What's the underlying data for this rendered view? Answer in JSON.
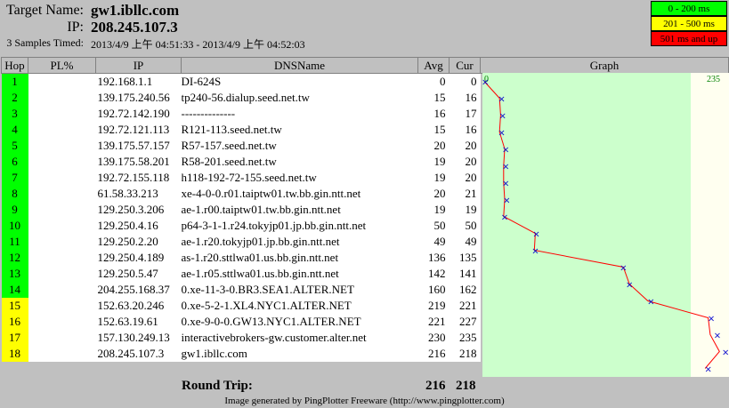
{
  "header": {
    "target_label": "Target Name:",
    "target_value": "gw1.ibllc.com",
    "ip_label": "IP:",
    "ip_value": "208.245.107.3",
    "samples_label": "3 Samples Timed:",
    "samples_value": "2013/4/9 上午 04:51:33 - 2013/4/9 上午 04:52:03"
  },
  "legend": [
    {
      "label": "0 - 200 ms",
      "color": "#00ff00"
    },
    {
      "label": "201 - 500 ms",
      "color": "#ffff00"
    },
    {
      "label": "501 ms and up",
      "color": "#ff0000"
    }
  ],
  "columns": {
    "hop": "Hop",
    "pl": "PL%",
    "ip": "IP",
    "dns": "DNSName",
    "avg": "Avg",
    "cur": "Cur",
    "graph": "Graph"
  },
  "graph_scale": {
    "min_label": "0",
    "max_label": "235",
    "max": 235
  },
  "colors": {
    "good": "#00ff00",
    "warn": "#ffff00",
    "graph_bg_good": "#ccffcc",
    "graph_bg_warn": "#fffff0",
    "line": "#ff0000",
    "marker": "#0000cc"
  },
  "rows": [
    {
      "hop": "1",
      "pl": "",
      "ip": "192.168.1.1",
      "dns": "DI-624S",
      "avg": "0",
      "cur": "0",
      "level": "good",
      "avg_val": 0,
      "cur_val": 0
    },
    {
      "hop": "2",
      "pl": "",
      "ip": "139.175.240.56",
      "dns": "tp240-56.dialup.seed.net.tw",
      "avg": "15",
      "cur": "16",
      "level": "good",
      "avg_val": 15,
      "cur_val": 16
    },
    {
      "hop": "3",
      "pl": "",
      "ip": "192.72.142.190",
      "dns": "--------------",
      "avg": "16",
      "cur": "17",
      "level": "good",
      "avg_val": 16,
      "cur_val": 17
    },
    {
      "hop": "4",
      "pl": "",
      "ip": "192.72.121.113",
      "dns": "R121-113.seed.net.tw",
      "avg": "15",
      "cur": "16",
      "level": "good",
      "avg_val": 15,
      "cur_val": 16
    },
    {
      "hop": "5",
      "pl": "",
      "ip": "139.175.57.157",
      "dns": "R57-157.seed.net.tw",
      "avg": "20",
      "cur": "20",
      "level": "good",
      "avg_val": 20,
      "cur_val": 20
    },
    {
      "hop": "6",
      "pl": "",
      "ip": "139.175.58.201",
      "dns": "R58-201.seed.net.tw",
      "avg": "19",
      "cur": "20",
      "level": "good",
      "avg_val": 19,
      "cur_val": 20
    },
    {
      "hop": "7",
      "pl": "",
      "ip": "192.72.155.118",
      "dns": "h118-192-72-155.seed.net.tw",
      "avg": "19",
      "cur": "20",
      "level": "good",
      "avg_val": 19,
      "cur_val": 20
    },
    {
      "hop": "8",
      "pl": "",
      "ip": "61.58.33.213",
      "dns": "xe-4-0-0.r01.taiptw01.tw.bb.gin.ntt.net",
      "avg": "20",
      "cur": "21",
      "level": "good",
      "avg_val": 20,
      "cur_val": 21
    },
    {
      "hop": "9",
      "pl": "",
      "ip": "129.250.3.206",
      "dns": "ae-1.r00.taiptw01.tw.bb.gin.ntt.net",
      "avg": "19",
      "cur": "19",
      "level": "good",
      "avg_val": 19,
      "cur_val": 19
    },
    {
      "hop": "10",
      "pl": "",
      "ip": "129.250.4.16",
      "dns": "p64-3-1-1.r24.tokyjp01.jp.bb.gin.ntt.net",
      "avg": "50",
      "cur": "50",
      "level": "good",
      "avg_val": 50,
      "cur_val": 50
    },
    {
      "hop": "11",
      "pl": "",
      "ip": "129.250.2.20",
      "dns": "ae-1.r20.tokyjp01.jp.bb.gin.ntt.net",
      "avg": "49",
      "cur": "49",
      "level": "good",
      "avg_val": 49,
      "cur_val": 49
    },
    {
      "hop": "12",
      "pl": "",
      "ip": "129.250.4.189",
      "dns": "as-1.r20.sttlwa01.us.bb.gin.ntt.net",
      "avg": "136",
      "cur": "135",
      "level": "good",
      "avg_val": 136,
      "cur_val": 135
    },
    {
      "hop": "13",
      "pl": "",
      "ip": "129.250.5.47",
      "dns": "ae-1.r05.sttlwa01.us.bb.gin.ntt.net",
      "avg": "142",
      "cur": "141",
      "level": "good",
      "avg_val": 142,
      "cur_val": 141
    },
    {
      "hop": "14",
      "pl": "",
      "ip": "204.255.168.37",
      "dns": "0.xe-11-3-0.BR3.SEA1.ALTER.NET",
      "avg": "160",
      "cur": "162",
      "level": "good",
      "avg_val": 160,
      "cur_val": 162
    },
    {
      "hop": "15",
      "pl": "",
      "ip": "152.63.20.246",
      "dns": "0.xe-5-2-1.XL4.NYC1.ALTER.NET",
      "avg": "219",
      "cur": "221",
      "level": "warn",
      "avg_val": 219,
      "cur_val": 221
    },
    {
      "hop": "16",
      "pl": "",
      "ip": "152.63.19.61",
      "dns": "0.xe-9-0-0.GW13.NYC1.ALTER.NET",
      "avg": "221",
      "cur": "227",
      "level": "warn",
      "avg_val": 221,
      "cur_val": 227
    },
    {
      "hop": "17",
      "pl": "",
      "ip": "157.130.249.13",
      "dns": "interactivebrokers-gw.customer.alter.net",
      "avg": "230",
      "cur": "235",
      "level": "warn",
      "avg_val": 230,
      "cur_val": 235
    },
    {
      "hop": "18",
      "pl": "",
      "ip": "208.245.107.3",
      "dns": "gw1.ibllc.com",
      "avg": "216",
      "cur": "218",
      "level": "warn",
      "avg_val": 216,
      "cur_val": 218
    }
  ],
  "footer": {
    "round_trip_label": "Round Trip:",
    "round_trip_avg": "216",
    "round_trip_cur": "218",
    "credit": "Image generated by PingPlotter Freeware (http://www.pingplotter.com)"
  }
}
